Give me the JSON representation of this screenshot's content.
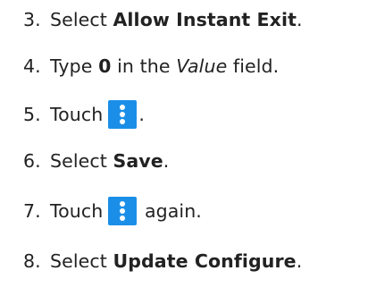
{
  "steps": [
    {
      "number": "3.",
      "parts": [
        "Select ",
        "Allow Instant Exit",
        "."
      ]
    },
    {
      "number": "4.",
      "parts": [
        "Type ",
        "0",
        " in the ",
        "Value",
        " field."
      ]
    },
    {
      "number": "5.",
      "parts": [
        "Touch ",
        "."
      ],
      "icon": "more-vert-icon"
    },
    {
      "number": "6.",
      "parts": [
        "Select ",
        "Save",
        "."
      ]
    },
    {
      "number": "7.",
      "parts": [
        "Touch ",
        " again."
      ],
      "icon": "more-vert-icon"
    },
    {
      "number": "8.",
      "parts": [
        "Select ",
        "Update Configure",
        "."
      ]
    }
  ],
  "icon_color": "#1b8fe8"
}
